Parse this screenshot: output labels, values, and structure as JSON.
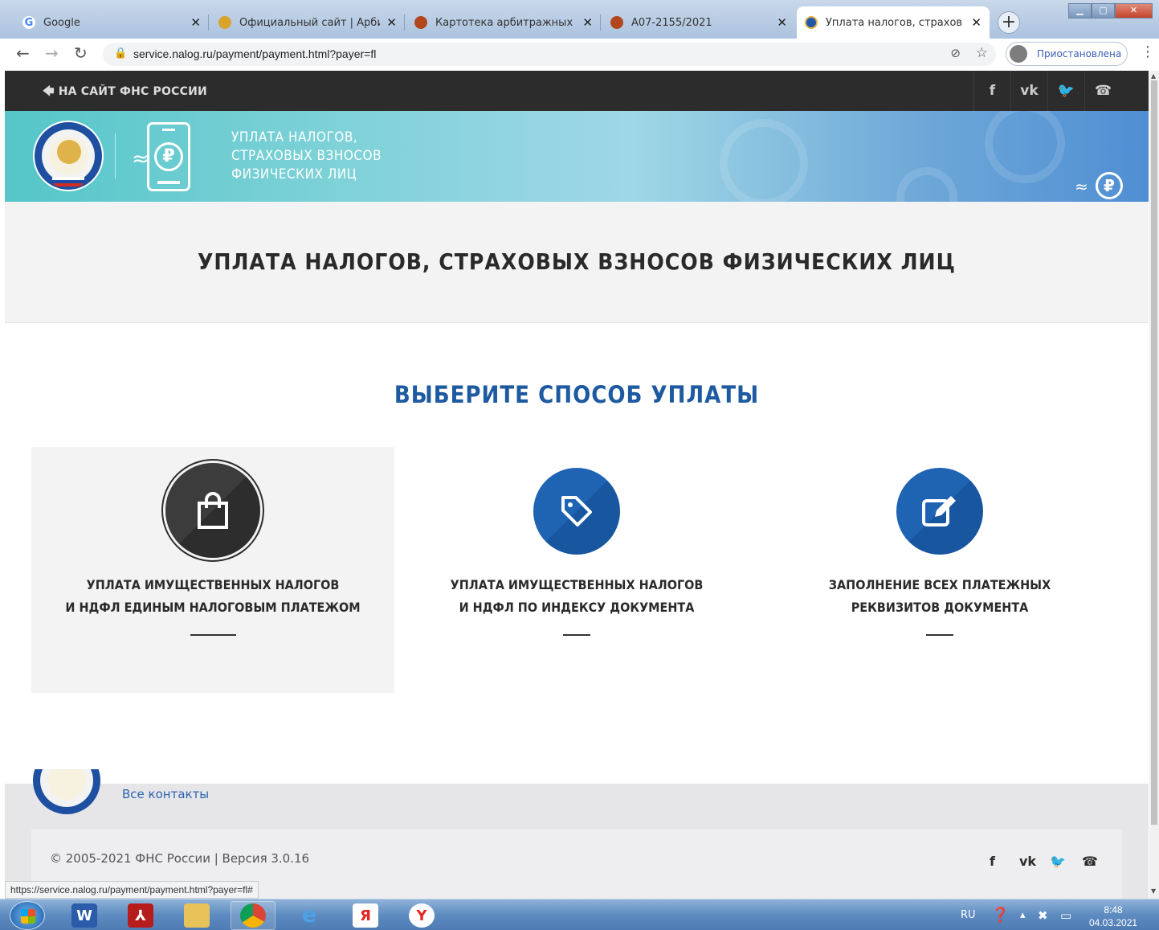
{
  "browser": {
    "tabs": [
      {
        "title": "Google",
        "icon": "google-icon"
      },
      {
        "title": "Официальный сайт | Арбит",
        "icon": "emblem-icon"
      },
      {
        "title": "Картотека арбитражных де",
        "icon": "emblem-icon"
      },
      {
        "title": "А07-2155/2021",
        "icon": "emblem-icon"
      },
      {
        "title": "Уплата налогов, страховых",
        "icon": "fns-icon"
      }
    ],
    "new_tab": "+",
    "url": "service.nalog.ru/payment/payment.html?payer=fl",
    "profile_status": "Приостановлена",
    "status_url": "https://service.nalog.ru/payment/payment.html?payer=fl#"
  },
  "site": {
    "back_link": "🡄 НА САЙТ ФНС РОССИИ",
    "social": [
      "f",
      "vk",
      "🐦",
      "☎"
    ],
    "banner_title": [
      "УПЛАТА НАЛОГОВ,",
      "СТРАХОВЫХ ВЗНОСОВ",
      "ФИЗИЧЕСКИХ ЛИЦ"
    ],
    "page_title": "УПЛАТА НАЛОГОВ, СТРАХОВЫХ ВЗНОСОВ ФИЗИЧЕСКИХ ЛИЦ",
    "choose_title": "ВЫБЕРИТЕ СПОСОБ УПЛАТЫ",
    "options": [
      {
        "line1": "УПЛАТА ИМУЩЕСТВЕННЫХ НАЛОГОВ",
        "line2": "И НДФЛ ЕДИНЫМ НАЛОГОВЫМ ПЛАТЕЖОМ",
        "icon": "shopping-bag-icon",
        "active": true
      },
      {
        "line1": "УПЛАТА ИМУЩЕСТВЕННЫХ НАЛОГОВ",
        "line2": "И НДФЛ ПО ИНДЕКСУ ДОКУМЕНТА",
        "icon": "tag-icon",
        "active": false
      },
      {
        "line1": "ЗАПОЛНЕНИЕ ВСЕХ ПЛАТЕЖНЫХ",
        "line2": "РЕКВИЗИТОВ ДОКУМЕНТА",
        "icon": "edit-icon",
        "active": false
      }
    ],
    "footer": {
      "contacts": "Все контакты",
      "copyright": "© 2005-2021 ФНС России   |   Версия 3.0.16"
    }
  },
  "taskbar": {
    "lang": "RU",
    "time": "8:48",
    "date": "04.03.2021"
  },
  "colors": {
    "accent": "#1e5aa0",
    "dark": "#2c2c2c",
    "band": "#f3f3f4"
  }
}
